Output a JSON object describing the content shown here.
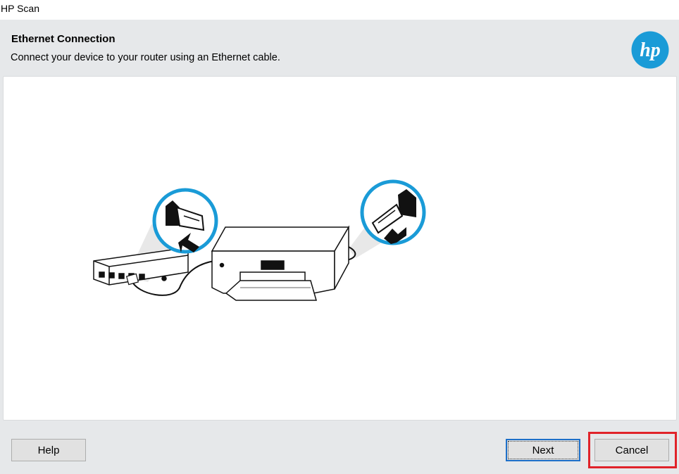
{
  "window": {
    "title": "HP Scan"
  },
  "header": {
    "heading": "Ethernet Connection",
    "subheading": "Connect your device to your router using an Ethernet cable.",
    "logo_text": "hp",
    "logo_color": "#1a9bd7"
  },
  "illustration": {
    "description_icon": "ethernet-router-printer-illustration",
    "accent_color": "#1a9bd7"
  },
  "footer": {
    "help_label": "Help",
    "next_label": "Next",
    "cancel_label": "Cancel",
    "highlight_color": "#e0232a"
  }
}
